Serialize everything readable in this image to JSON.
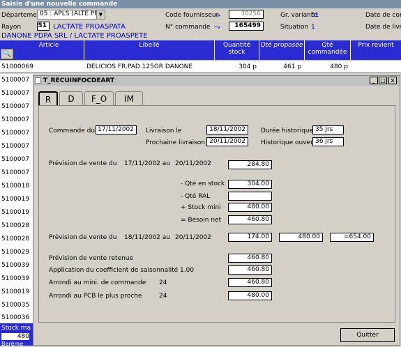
{
  "window": {
    "title": "Saisie d'une nouvelle commande"
  },
  "header": {
    "departement_label": "Département",
    "departement_value": "05 : APLS (ALTE PR",
    "code_fournisseur_label": "Code fournisseur",
    "code_fournisseur_value": "30256",
    "gr_variante_label": "Gr. variante",
    "gr_variante_value": "51",
    "date_commande_label": "Date de comm",
    "rayon_label": "Rayon",
    "rayon_value": "51",
    "rayon_name": "LACTATE PROASPATA",
    "n_commande_label": "N° commande",
    "n_commande_value": "165499",
    "situation_label": "Situation",
    "situation_value": "1",
    "date_livraison_label": "Date de livrais",
    "supplier_line": "DANONE PDPA SRL / LACTATE PROASPETE"
  },
  "grid": {
    "columns": [
      "Article",
      "Libellé",
      "Quantité stock",
      "Qté proposée",
      "Qté commandée",
      "Prix revient"
    ],
    "first_row": {
      "article": "51000069",
      "libelle": "DELICIOS FR.PAD.125GR DANONE",
      "stock": "304 p",
      "proposee": "461 p",
      "commandee": "480 p"
    },
    "row_codes": [
      "5100007",
      "5100007",
      "5100007",
      "5100007",
      "5100007",
      "5100007",
      "5100007",
      "5100007",
      "5100018",
      "5100019",
      "5100019",
      "5100028",
      "5100028",
      "5100029",
      "5100039",
      "5100039",
      "5100019",
      "5100035",
      "5100036"
    ],
    "bottom_label1": "Stock ma",
    "bottom_label2": "480",
    "bottom_label3": "Barème"
  },
  "dialog": {
    "title": "T_RECUINFOCDEART",
    "tabs": [
      "R",
      "D",
      "F_O",
      "IM"
    ],
    "commande_du_label": "Commande du",
    "commande_du_value": "17/11/2002",
    "livraison_le_label": "Livraison le",
    "livraison_le_value": "18/11/2002",
    "duree_hist_label": "Durée historique",
    "duree_hist_value": "35 Jrs",
    "prochaine_label": "Prochaine livraison le",
    "prochaine_value": "20/11/2002",
    "hist_ouvert_label": "Historique ouvert",
    "hist_ouvert_value": "36 jrs",
    "prev1_label": "Prévision de vente du",
    "prev1_from": "17/11/2002 au",
    "prev1_to": "20/11/2002",
    "prev1_value": "284.80",
    "qte_stock_label": "- Qté en stock",
    "qte_stock_value": "304.00",
    "qte_ral_label": "- Qté RAL",
    "qte_ral_value": "",
    "stock_mini_label": "+ Stock mini",
    "stock_mini_value": "480.00",
    "besoin_label": "= Besoin net",
    "besoin_value": "460.80",
    "prev2_label": "Prévision de vente du",
    "prev2_from": "18/11/2002 au",
    "prev2_to": "20/11/2002",
    "prev2_value": "174.00",
    "prev2_value2": "480.00",
    "prev2_value3": "=654.00",
    "retenue_label": "Prévision de vente retenue",
    "retenue_value": "460.80",
    "coef_label": "Application du coefficient de saisonnalité 1.00",
    "coef_value": "460.80",
    "arrondi_mini_label": "Arrondi au mini. de commande",
    "arrondi_mini_num": "24",
    "arrondi_mini_value": "460.80",
    "arrondi_pcb_label": "Arrondi au PCB le plus proche",
    "arrondi_pcb_num": "24",
    "arrondi_pcb_value": "480.00",
    "quit_label": "Quitter"
  }
}
